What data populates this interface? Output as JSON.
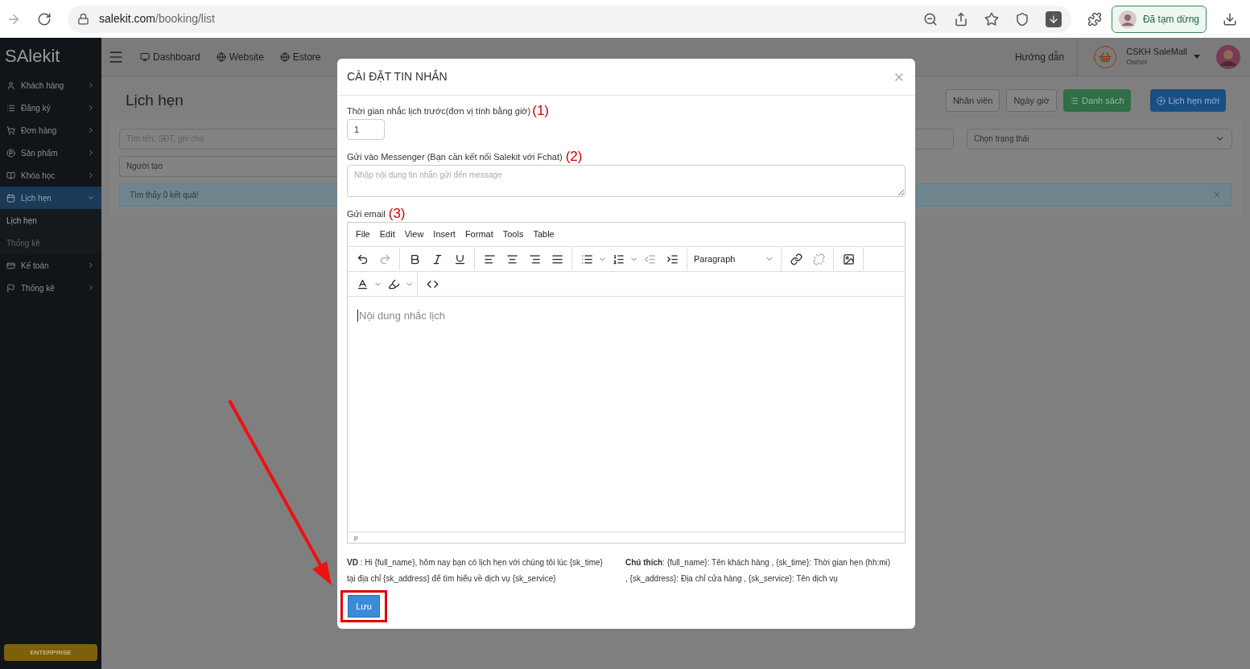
{
  "browser": {
    "url_host": "salekit.com",
    "url_path": "/booking/list",
    "profile_label": "Đã tạm dừng"
  },
  "sidebar": {
    "logo": "SAlekit",
    "enterprise": "ENTERPRISE",
    "items": [
      {
        "label": "Khách hàng",
        "selected": false,
        "expanded": false
      },
      {
        "label": "Đăng ký",
        "selected": false,
        "expanded": false
      },
      {
        "label": "Đơn hàng",
        "selected": false,
        "expanded": false
      },
      {
        "label": "Sản phẩm",
        "selected": false,
        "expanded": false
      },
      {
        "label": "Khóa học",
        "selected": false,
        "expanded": false
      },
      {
        "label": "Lịch hẹn",
        "selected": true,
        "expanded": true,
        "children": [
          {
            "label": "Lịch hẹn",
            "selected": true
          },
          {
            "label": "Thống kê",
            "selected": false
          }
        ]
      },
      {
        "label": "Kế toán",
        "selected": false,
        "expanded": false
      },
      {
        "label": "Thống kê",
        "selected": false,
        "expanded": false
      }
    ]
  },
  "topnav": {
    "items": [
      "Dashboard",
      "Website",
      "Estore"
    ],
    "help": "Hướng dẫn",
    "user_name": "CSKH SaleMall",
    "user_role": "Owner"
  },
  "page": {
    "title": "Lịch hẹn",
    "buttons": [
      {
        "label": "Nhân viên",
        "kind": "default"
      },
      {
        "label": "Ngày giờ",
        "kind": "default"
      },
      {
        "label": "Danh sách",
        "kind": "success"
      },
      {
        "label": "Lịch hẹn mới",
        "kind": "primary"
      }
    ],
    "search": {
      "placeholder": "Tìm tên, SĐT, ghi chú"
    },
    "creator": {
      "placeholder": "Người tạo"
    },
    "status": {
      "placeholder": "Chọn trạng thái"
    },
    "alert": "Tìm thấy 0 kết quả!"
  },
  "modal": {
    "title": "CÀI ĐẶT TIN NHẮN",
    "reminder": {
      "label": "Thời gian nhắc lịch trước(đơn vị tính bằng giờ)",
      "marker": "(1)",
      "value": "1"
    },
    "messenger": {
      "label": "Gửi vào Messenger (Bạn cần kết nối Salekit với Fchat)",
      "marker": "(2)",
      "placeholder": "Nhập nội dung tin nhắn gửi đến message"
    },
    "email": {
      "label": "Gửi email",
      "marker": "(3)",
      "menu": [
        "File",
        "Edit",
        "View",
        "Insert",
        "Format",
        "Tools",
        "Table"
      ],
      "block_format": "Paragraph",
      "placeholder": "Nội dung nhắc lịch",
      "path": "p"
    },
    "example": "**VD** : Hi {full_name}, hôm nay bạn có lịch hẹn với chúng tôi lúc {sk_time} tại địa chỉ {sk_address} để tìm hiểu về dịch vụ {sk_service}",
    "note": "**Chú thích**: {full_name}: Tên khách hàng , {sk_time}: Thời gian hẹn (hh:mi) , {sk_address}: Địa chỉ cửa hàng , {sk_service}: Tên dịch vụ",
    "save": "Lưu"
  }
}
